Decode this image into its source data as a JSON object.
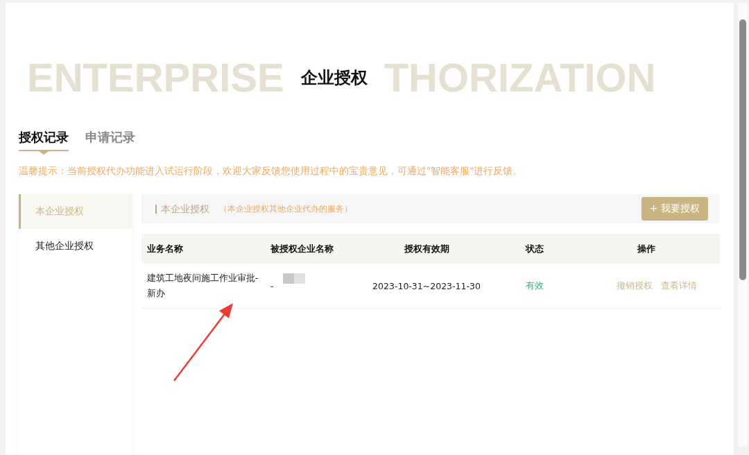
{
  "header": {
    "background_text_left": "ENTERPRISE",
    "title": "企业授权",
    "background_text_right": "THORIZATION"
  },
  "tabs": [
    {
      "label": "授权记录",
      "selected": true
    },
    {
      "label": "申请记录",
      "selected": false
    }
  ],
  "notice": "温馨提示：当前授权代办功能进入试运行阶段，欢迎大家反馈您使用过程中的宝贵意见，可通过\"智能客服\"进行反馈。",
  "sidebar": {
    "items": [
      {
        "label": "本企业授权",
        "selected": true
      },
      {
        "label": "其他企业授权",
        "selected": false
      }
    ]
  },
  "toolbar": {
    "title": "本企业授权",
    "hint": "（本企业授权其他企业代办的服务）",
    "button": "+ 我要授权"
  },
  "table": {
    "columns": [
      "业务名称",
      "被授权企业名称",
      "授权有效期",
      "状态",
      "操作"
    ],
    "rows": [
      {
        "business": "建筑工地夜间施工作业审批-新办",
        "company": "-",
        "company_redacted": true,
        "period": "2023-10-31~2023-11-30",
        "status": "有效",
        "color": "#2bb673",
        "actions": [
          "撤销授权",
          "查看详情"
        ]
      }
    ]
  },
  "annotation": {
    "kind": "arrow"
  }
}
